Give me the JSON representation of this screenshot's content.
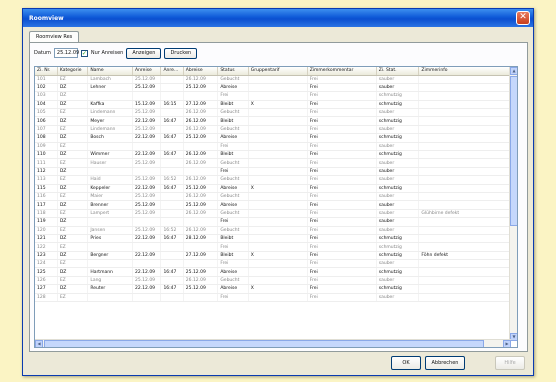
{
  "window": {
    "title": "Roomview"
  },
  "tabs": [
    {
      "label": "Roomview Res"
    }
  ],
  "filter": {
    "label": "Datum",
    "date_value": "25.12.09",
    "checkbox_label": "Nur Anreisen",
    "button1": "Anzeigen",
    "button2": "Drucken"
  },
  "columns": [
    "Zi. Nr.",
    "Kategorie",
    "Name",
    "Anreise",
    "Anre...",
    "Abreise",
    "Status",
    "Gruppentarif",
    "Zimmerkommentar",
    "Zi. Stat.",
    "Zimmerinfo"
  ],
  "rows": [
    [
      "101",
      "EZ",
      "Lambach",
      "25.12.09",
      "",
      "26.12.09",
      "Gebucht",
      "",
      "Frei",
      "sauber",
      ""
    ],
    [
      "102",
      "DZ",
      "Lehner",
      "25.12.09",
      "",
      "25.12.09",
      "Abreise",
      "",
      "Frei",
      "sauber",
      ""
    ],
    [
      "103",
      "DZ",
      "",
      "",
      "",
      "",
      "Frei",
      "",
      "Frei",
      "schmutzig",
      ""
    ],
    [
      "104",
      "DZ",
      "Kaffka",
      "15.12.09",
      "16:15",
      "27.12.09",
      "Bleibt",
      "X",
      "Frei",
      "schmutzig",
      ""
    ],
    [
      "105",
      "EZ",
      "Lindemann",
      "25.12.09",
      "",
      "26.12.09",
      "Gebucht",
      "",
      "Frei",
      "sauber",
      ""
    ],
    [
      "106",
      "DZ",
      "Meyer",
      "22.12.09",
      "16:47",
      "26.12.09",
      "Bleibt",
      "",
      "Frei",
      "schmutzig",
      ""
    ],
    [
      "107",
      "EZ",
      "Lindemann",
      "25.12.09",
      "",
      "26.12.09",
      "Gebucht",
      "",
      "Frei",
      "sauber",
      ""
    ],
    [
      "108",
      "DZ",
      "Bosch",
      "22.12.09",
      "16:47",
      "25.12.09",
      "Abreise",
      "",
      "Frei",
      "schmutzig",
      ""
    ],
    [
      "109",
      "EZ",
      "",
      "",
      "",
      "",
      "Frei",
      "",
      "Frei",
      "sauber",
      ""
    ],
    [
      "110",
      "DZ",
      "Wimmer",
      "22.12.09",
      "16:47",
      "26.12.09",
      "Bleibt",
      "",
      "Frei",
      "schmutzig",
      ""
    ],
    [
      "111",
      "EZ",
      "Hauser",
      "25.12.09",
      "",
      "26.12.09",
      "Gebucht",
      "",
      "Frei",
      "sauber",
      ""
    ],
    [
      "112",
      "DZ",
      "",
      "",
      "",
      "",
      "Frei",
      "",
      "Frei",
      "sauber",
      ""
    ],
    [
      "113",
      "EZ",
      "Haid",
      "25.12.09",
      "16:52",
      "26.12.09",
      "Gebucht",
      "",
      "Frei",
      "sauber",
      ""
    ],
    [
      "115",
      "DZ",
      "Keppeler",
      "22.12.09",
      "16:47",
      "25.12.09",
      "Abreise",
      "X",
      "Frei",
      "schmutzig",
      ""
    ],
    [
      "116",
      "EZ",
      "Maier",
      "25.12.09",
      "",
      "26.12.09",
      "Gebucht",
      "",
      "Frei",
      "sauber",
      ""
    ],
    [
      "117",
      "DZ",
      "Brenner",
      "25.12.09",
      "",
      "25.12.09",
      "Abreise",
      "",
      "Frei",
      "sauber",
      ""
    ],
    [
      "118",
      "EZ",
      "Lampert",
      "25.12.09",
      "",
      "26.12.09",
      "Gebucht",
      "",
      "Frei",
      "sauber",
      "Glühbirne defekt"
    ],
    [
      "119",
      "DZ",
      "",
      "",
      "",
      "",
      "Frei",
      "",
      "Frei",
      "sauber",
      ""
    ],
    [
      "120",
      "EZ",
      "Jansen",
      "25.12.09",
      "16:52",
      "26.12.09",
      "Gebucht",
      "",
      "Frei",
      "sauber",
      ""
    ],
    [
      "121",
      "DZ",
      "Pries",
      "22.12.09",
      "16:47",
      "28.12.09",
      "Bleibt",
      "",
      "Frei",
      "schmutzig",
      ""
    ],
    [
      "122",
      "EZ",
      "",
      "",
      "",
      "",
      "Frei",
      "",
      "Frei",
      "schmutzig",
      ""
    ],
    [
      "123",
      "DZ",
      "Bergner",
      "22.12.09",
      "",
      "27.12.09",
      "Bleibt",
      "X",
      "Frei",
      "schmutzig",
      "Föhn defekt"
    ],
    [
      "124",
      "EZ",
      "",
      "",
      "",
      "",
      "Frei",
      "",
      "Frei",
      "sauber",
      ""
    ],
    [
      "125",
      "DZ",
      "Hartmann",
      "22.12.09",
      "16:47",
      "25.12.09",
      "Abreise",
      "",
      "Frei",
      "schmutzig",
      ""
    ],
    [
      "126",
      "EZ",
      "Lang",
      "25.12.09",
      "",
      "26.12.09",
      "Gebucht",
      "",
      "Frei",
      "sauber",
      ""
    ],
    [
      "127",
      "DZ",
      "Reuter",
      "22.12.09",
      "16:47",
      "25.12.09",
      "Abreise",
      "X",
      "Frei",
      "schmutzig",
      ""
    ],
    [
      "128",
      "EZ",
      "",
      "",
      "",
      "",
      "Frei",
      "",
      "Frei",
      "sauber",
      ""
    ]
  ],
  "dim_rows": [
    0,
    2,
    4,
    6,
    8,
    10,
    12,
    14,
    16,
    18,
    20,
    22,
    24,
    26
  ],
  "footer": {
    "ok": "OK",
    "cancel": "Abbrechen",
    "apply": "Hilfe"
  }
}
